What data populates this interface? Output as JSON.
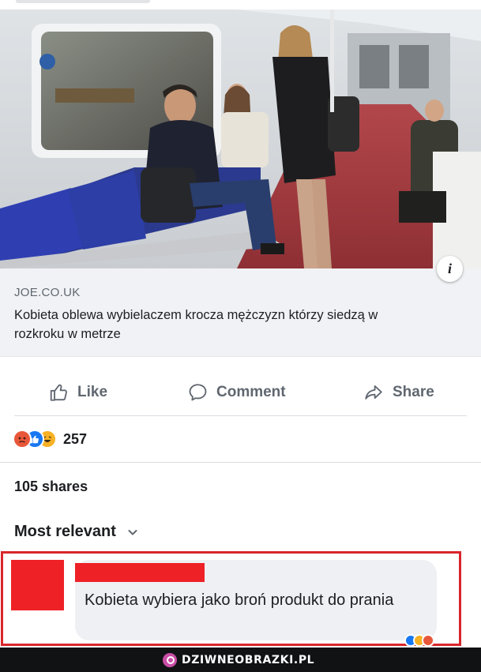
{
  "link": {
    "domain": "JOE.CO.UK",
    "title": "Kobieta oblewa wybielaczem krocza mężczyzn którzy siedzą w rozkroku w metrze",
    "info_icon": "info-icon",
    "info_glyph": "i"
  },
  "actions": {
    "like": {
      "label": "Like",
      "icon": "thumbs-up-icon"
    },
    "comment": {
      "label": "Comment",
      "icon": "comment-icon"
    },
    "share": {
      "label": "Share",
      "icon": "share-icon"
    }
  },
  "reactions": {
    "types": [
      "angry",
      "like",
      "haha"
    ],
    "count": "257",
    "colors": {
      "angry": "#e8573a",
      "like": "#1877f2",
      "haha": "#f7b125"
    }
  },
  "shares_text": "105 shares",
  "sort": {
    "label": "Most relevant",
    "icon": "chevron-down-icon"
  },
  "comment": {
    "text": "Kobieta wybiera jako broń produkt do prania",
    "redaction_color": "#ee2127",
    "highlight_color": "#d9262b"
  },
  "watermark": {
    "text": "DZIWNEOBRAZKI.PL",
    "logo": "dziwneobrazki-logo-icon"
  }
}
